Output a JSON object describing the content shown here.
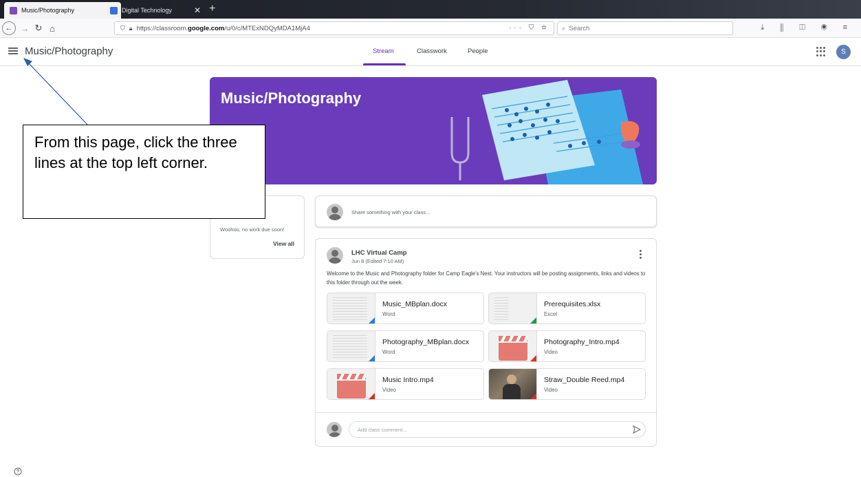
{
  "browser": {
    "tabs": [
      {
        "label": "Music/Photography",
        "active": true,
        "favicon_color": "#7c4dba"
      },
      {
        "label": "Digital Technology",
        "active": false,
        "favicon_color": "#3a6fd8"
      }
    ],
    "url_prefix": "https://classroom.",
    "url_domain": "google.com",
    "url_path": "/u/0/c/MTExNDQyMDA1MjA4",
    "url_actions": "··· ⛉ ☆",
    "search_placeholder": "Search"
  },
  "header": {
    "title": "Music/Photography",
    "tabs": [
      {
        "label": "Stream",
        "active": true
      },
      {
        "label": "Classwork",
        "active": false
      },
      {
        "label": "People",
        "active": false
      }
    ],
    "avatar_initial": "S"
  },
  "banner": {
    "title": "Music/Photography",
    "color": "#6a3cbc"
  },
  "upcoming": {
    "empty_text": "Woohoo, no work due soon!",
    "view_all": "View all"
  },
  "share": {
    "placeholder": "Share something with your class..."
  },
  "post": {
    "author": "LHC Virtual Camp",
    "date": "Jun 8 (Edited 7:10 AM)",
    "body": "Welcome to the Music and Photography folder for Camp Eagle's Nest. Your instructors will be posting assignments, links and videos to this folder through out the week.",
    "attachments": [
      {
        "name": "Music_MBplan.docx",
        "type": "Word"
      },
      {
        "name": "Prerequisites.xlsx",
        "type": "Excel"
      },
      {
        "name": "Photography_MBplan.docx",
        "type": "Word"
      },
      {
        "name": "Photography_Intro.mp4",
        "type": "Video"
      },
      {
        "name": "Music Intro.mp4",
        "type": "Video"
      },
      {
        "name": "Straw_Double Reed.mp4",
        "type": "Video"
      }
    ],
    "comment_placeholder": "Add class comment..."
  },
  "annotation": {
    "text": "From this page, click the three lines at the top left corner."
  }
}
